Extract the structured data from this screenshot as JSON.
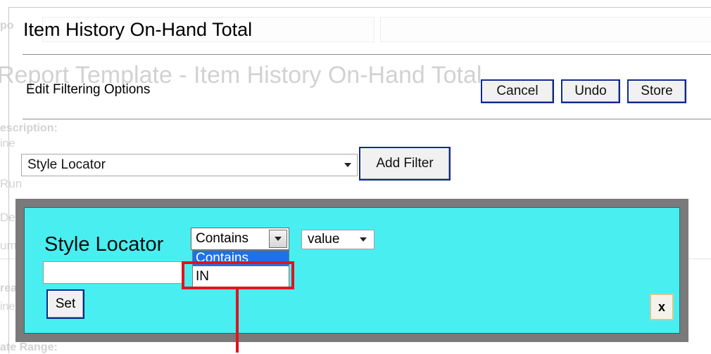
{
  "background": {
    "title": "Report Template - Item History On-Hand Total",
    "labels": [
      "escription:",
      "ine",
      "Run",
      "Delete",
      "ummary",
      "reated",
      "ine",
      "ate Range:"
    ]
  },
  "dialog": {
    "title": "Item History On-Hand Total",
    "subtitle": "Edit Filtering Options",
    "buttons": {
      "cancel": "Cancel",
      "undo": "Undo",
      "store": "Store"
    }
  },
  "filter_selector": {
    "selected": "Style Locator",
    "add_button": "Add Filter"
  },
  "filter_panel": {
    "name": "Style Locator",
    "operator": {
      "selected": "Contains",
      "options": [
        "Contains",
        "IN"
      ]
    },
    "value_type": "value",
    "value_input": "",
    "set_button": "Set",
    "remove_button": "x"
  },
  "colors": {
    "panel_bg": "#49eef1",
    "button_border": "#0b2a8f",
    "highlight": "#e3121d",
    "dropdown_selected": "#1a73e8"
  }
}
